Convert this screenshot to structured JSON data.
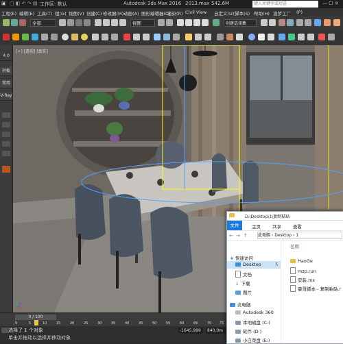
{
  "titlebar": {
    "workspace": "工作区: 默认",
    "app": "Autodesk 3ds Max 2016",
    "file": "2013.max",
    "size": "542.6M",
    "search_placeholder": "键入关键字或短语"
  },
  "menu": {
    "items": [
      "工程(E)",
      "编辑(E)",
      "工具(T)",
      "组(G)",
      "视图(V)",
      "创建(C)",
      "修改器(M)",
      "动画(A)",
      "图形编辑器(D)",
      "渲染(R)",
      "Civil View",
      "自定义(U)",
      "脚本(S)",
      "帮助(H)",
      "渲梦工厂",
      "(P)"
    ]
  },
  "toolbar": {
    "selection_filter": "全部",
    "ref_coord": "视图",
    "named_set": "创建选择集"
  },
  "left_panel": {
    "items": [
      "4.0",
      "衬板",
      "常用",
      "V-Ray"
    ]
  },
  "viewport": {
    "label": "[+] [透视] [真实]"
  },
  "timeline": {
    "frame": "0 / 100",
    "ticks": [
      "0",
      "5",
      "10",
      "15",
      "20",
      "25",
      "30",
      "35",
      "40",
      "45",
      "50",
      "55",
      "60",
      "65",
      "70",
      "75"
    ]
  },
  "status": {
    "selected": "选择了 1 个对象",
    "prompt": "单击并拖动以选择并移动对象",
    "x_value": "-1645.999",
    "y_value": "840.0m"
  },
  "explorer": {
    "title": "D:\\Desktop\\1\\复制粘贴",
    "tabs": [
      "文件",
      "主页",
      "共享",
      "查看"
    ],
    "breadcrumb": [
      "此电脑",
      "Desktop",
      "1"
    ],
    "nav": [
      {
        "label": "快速访问",
        "kind": "star"
      },
      {
        "label": "Desktop",
        "kind": "folder-blue"
      },
      {
        "label": "文档",
        "kind": "doc"
      },
      {
        "label": "下载",
        "kind": "down"
      },
      {
        "label": "图片",
        "kind": "pic"
      },
      {
        "label": "此电脑",
        "kind": "pc"
      },
      {
        "label": "Autodesk 360",
        "kind": "cloud"
      },
      {
        "label": "本地磁盘 (C:)",
        "kind": "drive"
      },
      {
        "label": "软件 (D:)",
        "kind": "drive"
      },
      {
        "label": "小白菜盘 (E:)",
        "kind": "drive"
      }
    ],
    "header_name": "名称",
    "files": [
      {
        "name": "HaoGe",
        "type": "folder"
      },
      {
        "name": "mzp.run",
        "type": "file"
      },
      {
        "name": "安装.ms",
        "type": "file"
      },
      {
        "name": "豪哥脚本 - 复制粘贴.r",
        "type": "file"
      }
    ]
  },
  "colors": {
    "accent": "#1e78d7",
    "wall": "#7b7570",
    "curtain": "#8d7f70",
    "chair": "#4a5560",
    "table_top": "#c9c6c2",
    "selection": "#ffff00"
  }
}
